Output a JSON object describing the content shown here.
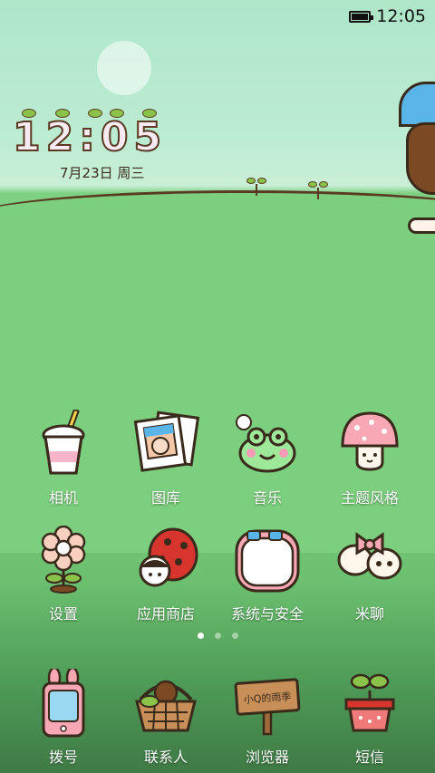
{
  "status_bar": {
    "time": "12:05",
    "battery_icon": "battery-full-icon"
  },
  "clock_widget": {
    "digits": [
      "1",
      "2",
      ":",
      "0",
      "5"
    ],
    "date": "7月23日 周三"
  },
  "apps_row1": [
    {
      "label": "相机",
      "icon": "camera-cup-icon"
    },
    {
      "label": "图库",
      "icon": "gallery-photos-icon"
    },
    {
      "label": "音乐",
      "icon": "music-frog-icon"
    },
    {
      "label": "主题风格",
      "icon": "theme-mushroom-icon"
    }
  ],
  "apps_row2": [
    {
      "label": "设置",
      "icon": "settings-flower-icon"
    },
    {
      "label": "应用商店",
      "icon": "app-store-ladybug-icon"
    },
    {
      "label": "系统与安全",
      "icon": "security-tv-icon"
    },
    {
      "label": "米聊",
      "icon": "miliao-bow-icon"
    }
  ],
  "dock": [
    {
      "label": "拨号",
      "icon": "phone-bunny-icon"
    },
    {
      "label": "联系人",
      "icon": "contacts-basket-icon"
    },
    {
      "label": "浏览器",
      "icon": "browser-sign-icon"
    },
    {
      "label": "短信",
      "icon": "messages-plant-icon"
    }
  ],
  "browser_sign_text": "小Q的雨季",
  "page_indicator": {
    "pages": 3,
    "active": 1
  },
  "colors": {
    "grass": "#7ccf7e",
    "sky": "#aee6c8",
    "outline": "#5a3a22",
    "label_text": "#ffffff"
  }
}
